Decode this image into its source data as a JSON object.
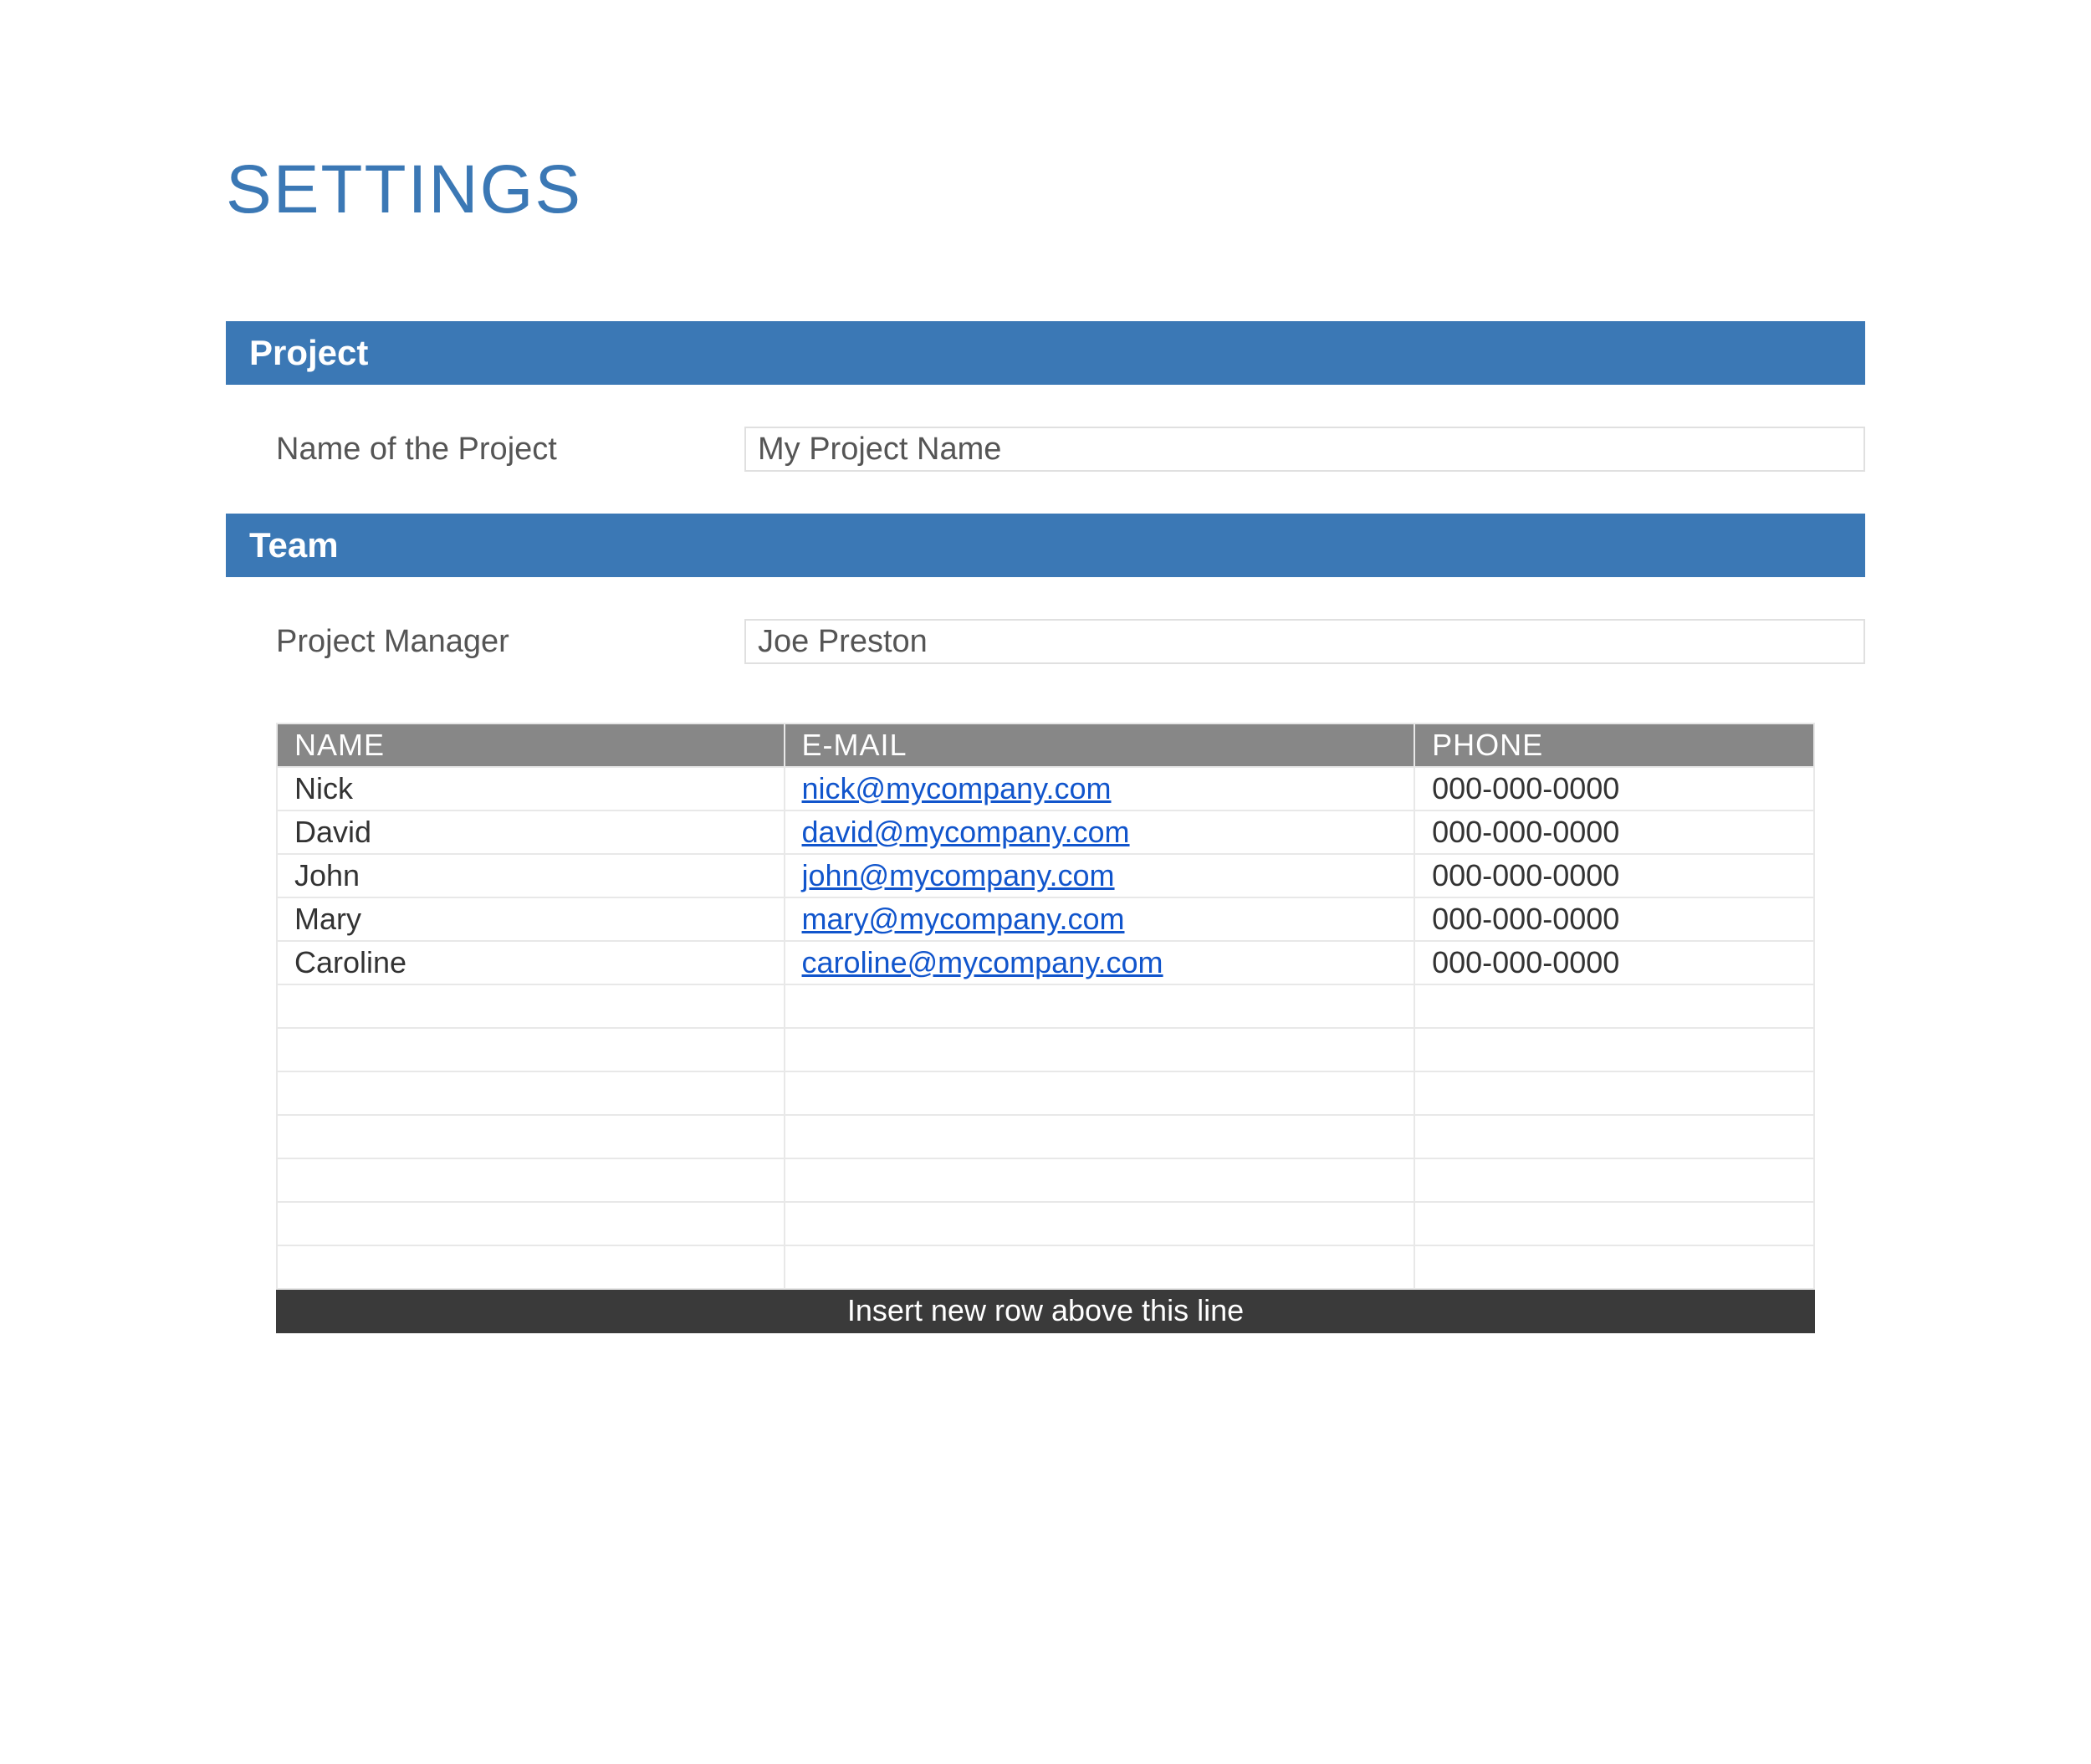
{
  "title": "SETTINGS",
  "sections": {
    "project": {
      "header": "Project",
      "name_label": "Name of the Project",
      "name_value": "My Project Name"
    },
    "team": {
      "header": "Team",
      "manager_label": "Project Manager",
      "manager_value": "Joe Preston",
      "columns": {
        "name": "NAME",
        "email": "E-MAIL",
        "phone": "PHONE"
      },
      "rows": [
        {
          "name": "Nick",
          "email": "nick@mycompany.com",
          "phone": "000-000-0000"
        },
        {
          "name": "David",
          "email": "david@mycompany.com",
          "phone": "000-000-0000"
        },
        {
          "name": "John",
          "email": "john@mycompany.com",
          "phone": "000-000-0000"
        },
        {
          "name": "Mary",
          "email": "mary@mycompany.com",
          "phone": "000-000-0000"
        },
        {
          "name": "Caroline",
          "email": "caroline@mycompany.com",
          "phone": "000-000-0000"
        }
      ],
      "empty_rows": 7,
      "footer": "Insert new row above this line"
    }
  }
}
